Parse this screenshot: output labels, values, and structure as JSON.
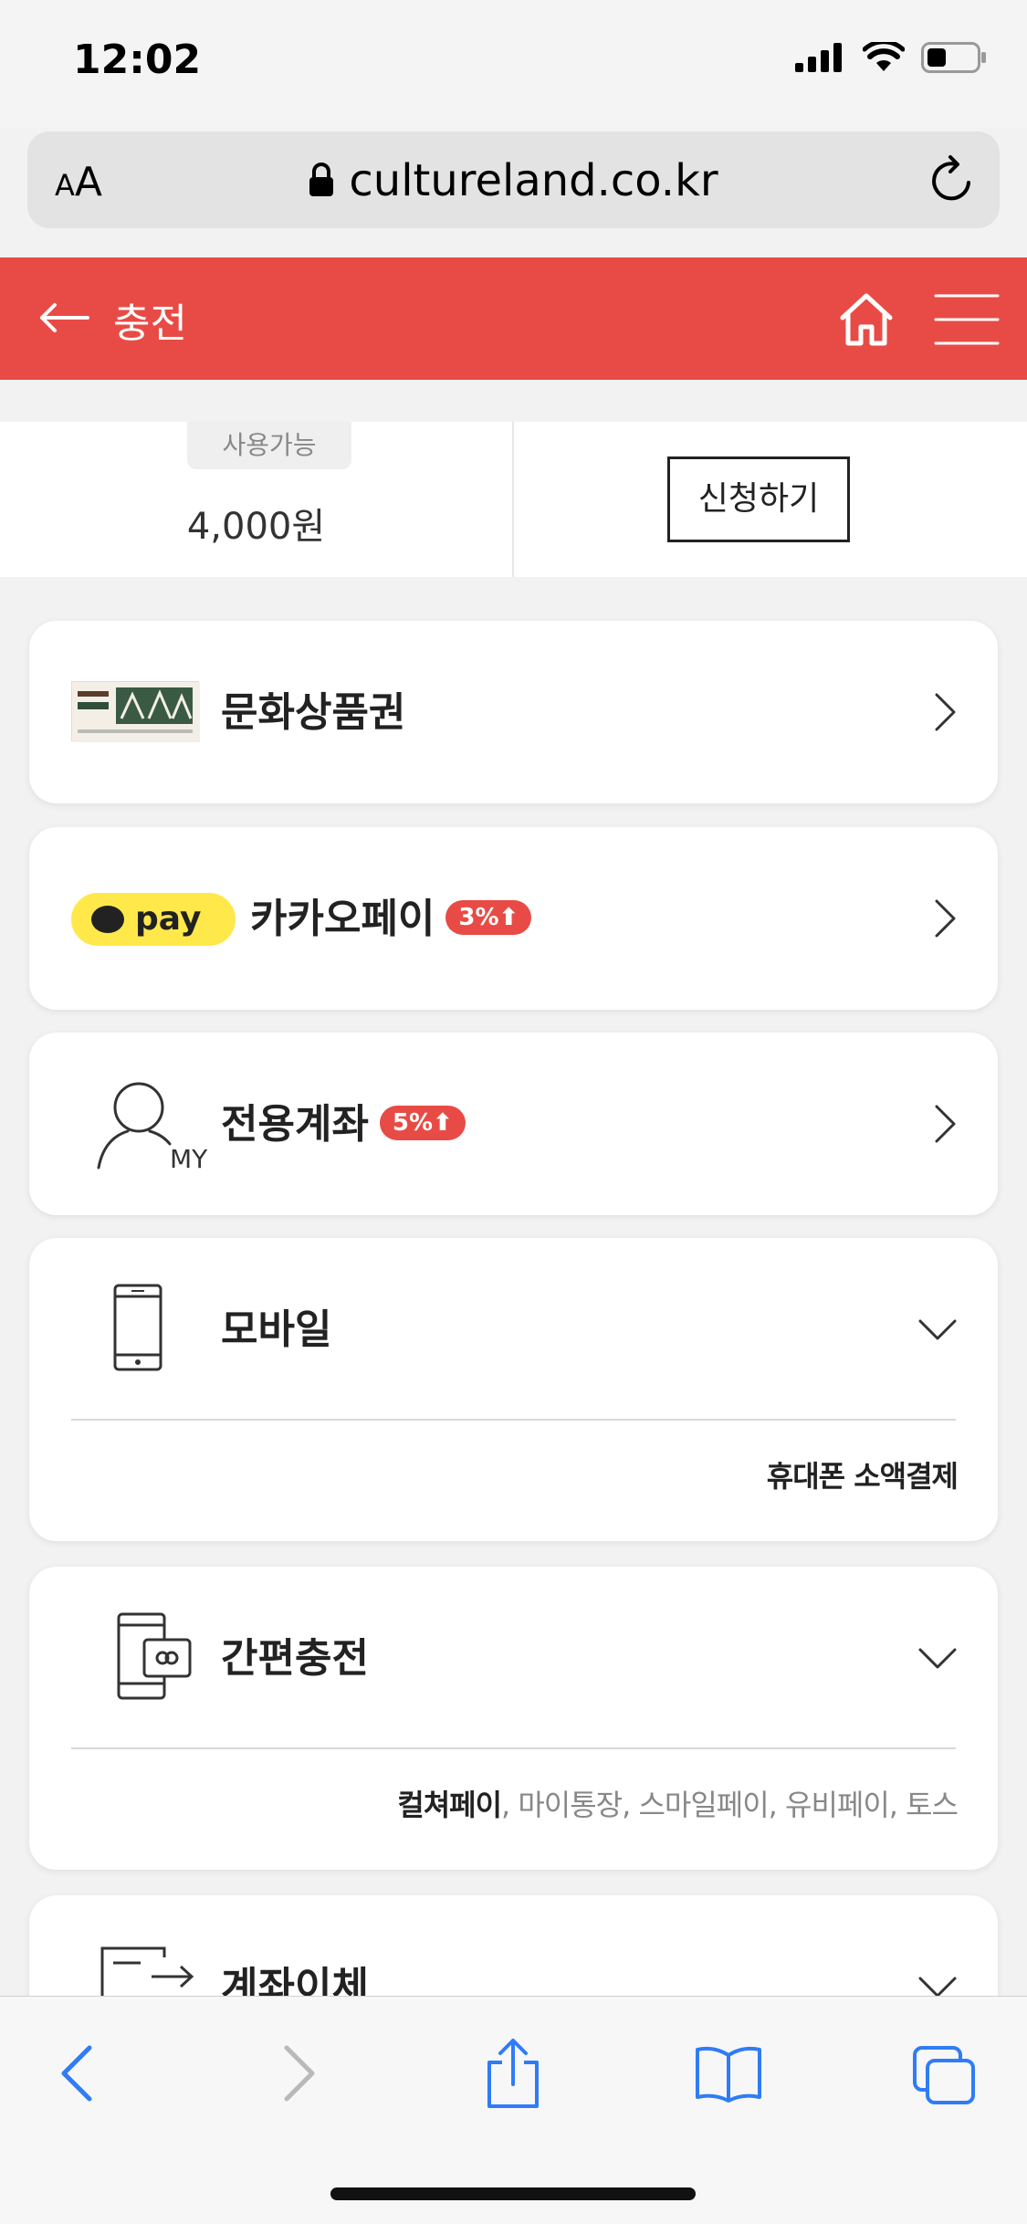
{
  "status_bar": {
    "time": "12:02"
  },
  "browser": {
    "aa_label_small": "A",
    "aa_label_large": "A",
    "url": "cultureland.co.kr"
  },
  "header": {
    "title": "충전"
  },
  "balance": {
    "available_label": "사용가능",
    "amount": "4,000원",
    "apply_label": "신청하기"
  },
  "methods": [
    {
      "title": "문화상품권"
    },
    {
      "title": "카카오페이",
      "badge": "3%⬆",
      "logo_text": "pay"
    },
    {
      "title": "전용계좌",
      "badge": "5%⬆",
      "icon_text": "MY"
    },
    {
      "title": "모바일",
      "sub": "휴대폰 소액결제"
    },
    {
      "title": "간편충전",
      "sub_bold": "컬쳐페이",
      "sub_rest": ", 마이통장, 스마일페이, 유비페이, 토스"
    },
    {
      "title": "계좌이체"
    }
  ],
  "colors": {
    "brand_red": "#e84b45",
    "kakao_yellow": "#ffe84a",
    "ios_blue": "#2f7cf6"
  }
}
